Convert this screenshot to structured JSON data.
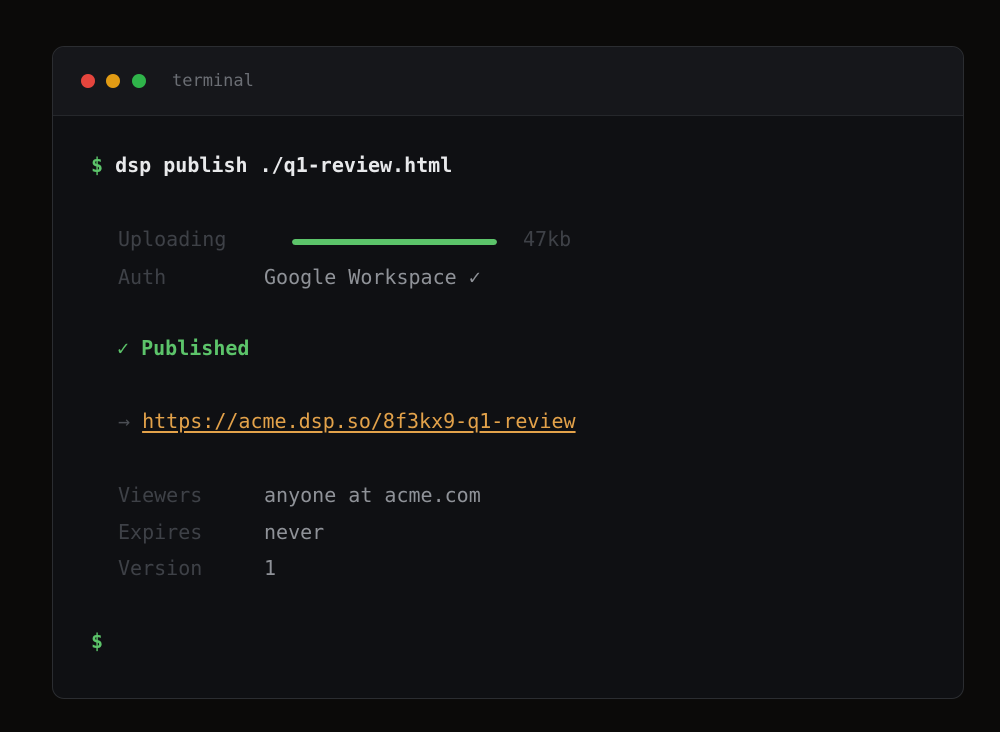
{
  "window": {
    "title": "terminal"
  },
  "command": {
    "prompt": "$",
    "text": "dsp publish ./q1-review.html"
  },
  "upload": {
    "label": "Uploading",
    "progress": 1.0,
    "size": "47kb"
  },
  "auth": {
    "label": "Auth",
    "value": "Google Workspace ✓"
  },
  "result": {
    "check": "✓",
    "status": "Published"
  },
  "link": {
    "arrow": "→",
    "url": "https://acme.dsp.so/8f3kx9-q1-review"
  },
  "details": [
    {
      "label": "Viewers",
      "value": "anyone at acme.com"
    },
    {
      "label": "Expires",
      "value": "never"
    },
    {
      "label": "Version",
      "value": "1"
    }
  ],
  "final_prompt": "$",
  "colors": {
    "prompt": "#5cc46a",
    "link": "#e3a24a",
    "dot_red": "#e5453d",
    "dot_yellow": "#e19b14",
    "dot_green": "#2fb44a"
  }
}
